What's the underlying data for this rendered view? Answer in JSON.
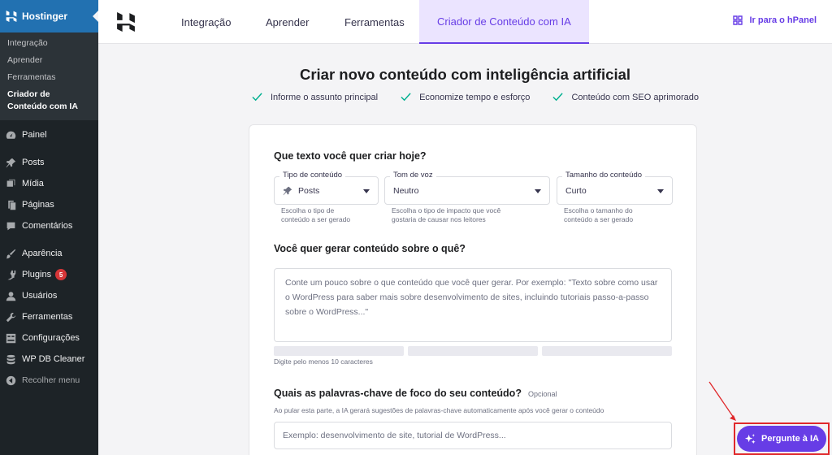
{
  "sidebar": {
    "brand": "Hostinger",
    "sub_items": [
      {
        "label": "Integração"
      },
      {
        "label": "Aprender"
      },
      {
        "label": "Ferramentas"
      },
      {
        "label": "Criador de Conteúdo com IA"
      }
    ],
    "items": [
      {
        "label": "Painel",
        "icon": "dashboard-icon"
      },
      {
        "label": "Posts",
        "icon": "pin-icon"
      },
      {
        "label": "Mídia",
        "icon": "media-icon"
      },
      {
        "label": "Páginas",
        "icon": "pages-icon"
      },
      {
        "label": "Comentários",
        "icon": "comment-icon"
      },
      {
        "label": "Aparência",
        "icon": "brush-icon"
      },
      {
        "label": "Plugins",
        "icon": "plugin-icon",
        "badge": "5"
      },
      {
        "label": "Usuários",
        "icon": "user-icon"
      },
      {
        "label": "Ferramentas",
        "icon": "wrench-icon"
      },
      {
        "label": "Configurações",
        "icon": "settings-icon"
      },
      {
        "label": "WP DB Cleaner",
        "icon": "database-icon"
      }
    ],
    "collapse_label": "Recolher menu"
  },
  "topnav": {
    "tabs": [
      "Integração",
      "Aprender",
      "Ferramentas",
      "Criador de Conteúdo com IA"
    ],
    "hpanel_label": "Ir para o hPanel"
  },
  "main": {
    "title": "Criar novo conteúdo com inteligência artificial",
    "benefits": [
      "Informe o assunto principal",
      "Economize tempo e esforço",
      "Conteúdo com SEO aprimorado"
    ]
  },
  "form": {
    "section1_title": "Que texto você quer criar hoje?",
    "content_type": {
      "label": "Tipo de conteúdo",
      "value": "Posts",
      "help": [
        "Escolha o tipo de",
        "conteúdo a ser gerado"
      ]
    },
    "tone": {
      "label": "Tom de voz",
      "value": "Neutro",
      "help": [
        "Escolha o tipo de impacto que você",
        "gostaria de causar nos leitores"
      ]
    },
    "length": {
      "label": "Tamanho do conteúdo",
      "value": "Curto",
      "help": [
        "Escolha o tamanho do",
        "conteúdo a ser gerado"
      ]
    },
    "section2_title": "Você quer gerar conteúdo sobre o quê?",
    "topic_placeholder": "Conte um pouco sobre o que conteúdo que você quer gerar. Por exemplo: \"Texto sobre como usar o WordPress para saber mais sobre desenvolvimento de sites, incluindo tutoriais passo-a-passo sobre o WordPress...\"",
    "min_hint": "Digite pelo menos 10 caracteres",
    "section3_title": "Quais as palavras-chave de foco do seu conteúdo?",
    "optional_label": "Opcional",
    "keywords_hint": "Ao pular esta parte, a IA gerará sugestões de palavras-chave automaticamente após você gerar o conteúdo",
    "keywords_placeholder": "Exemplo: desenvolvimento de site, tutorial de WordPress..."
  },
  "ai_button": {
    "label": "Pergunte à IA"
  },
  "colors": {
    "accent": "#673de6",
    "wp_sidebar": "#1d2327",
    "wp_blue": "#2271b1",
    "check": "#00b090",
    "highlight": "#e0282b"
  }
}
